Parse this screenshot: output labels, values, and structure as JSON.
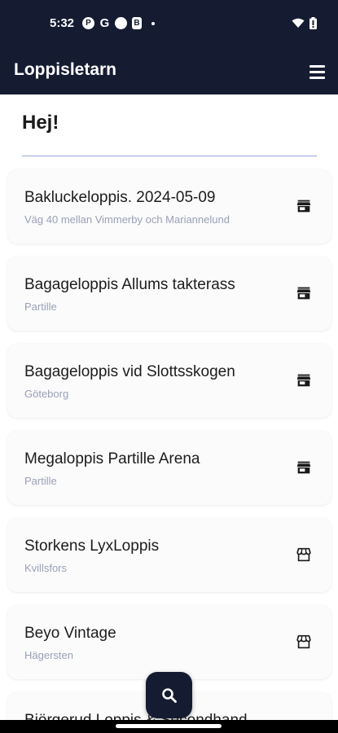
{
  "status": {
    "time": "5:32",
    "left_icons": [
      "pocket-casts-icon",
      "google-icon",
      "circle-notification-icon",
      "app-notification-icon"
    ]
  },
  "app": {
    "title": "Loppisletarn"
  },
  "greeting": "Hej!",
  "items": [
    {
      "title": "Bakluckeloppis. 2024-05-09",
      "subtitle": "Väg 40 mellan Vimmerby och Mariannelund",
      "icon": "store-filled-icon"
    },
    {
      "title": "Bagageloppis Allums takterass",
      "subtitle": "Partille",
      "icon": "store-filled-icon"
    },
    {
      "title": "Bagageloppis vid Slottsskogen",
      "subtitle": "Göteborg",
      "icon": "store-filled-icon"
    },
    {
      "title": "Megaloppis Partille Arena",
      "subtitle": "Partille",
      "icon": "store-filled-icon"
    },
    {
      "title": "Storkens LyxLoppis",
      "subtitle": "Kvillsfors",
      "icon": "storefront-outline-icon"
    },
    {
      "title": "Beyo Vintage",
      "subtitle": "Hägersten",
      "icon": "storefront-outline-icon"
    },
    {
      "title": "Björgerud Loppis & Secondhand",
      "subtitle": "",
      "icon": "storefront-outline-icon"
    }
  ],
  "colors": {
    "primary": "#151c32",
    "card_bg": "#fbfbfc",
    "subtitle": "#9aa0b5",
    "divider": "#9aa3dc"
  }
}
